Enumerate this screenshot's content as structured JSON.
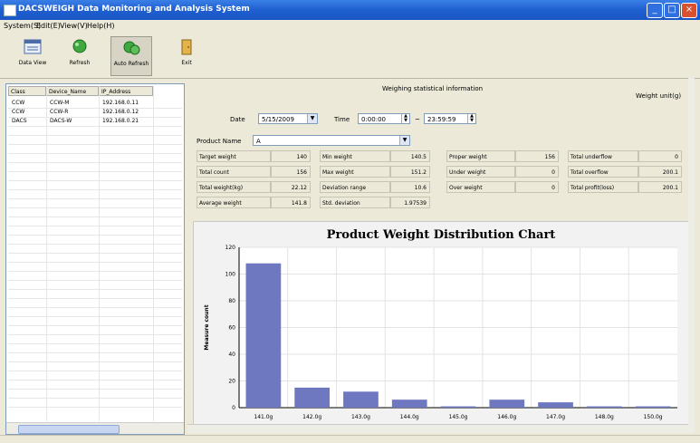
{
  "window": {
    "title": "DACSWEIGH Data Monitoring and Analysis System"
  },
  "menu": [
    "System(S)",
    "Edit(E)",
    "View(V)",
    "Help(H)"
  ],
  "toolbar": {
    "buttons": [
      {
        "label": "Data View",
        "icon": "data-view-icon"
      },
      {
        "label": "Refresh",
        "icon": "refresh-icon"
      },
      {
        "label": "Auto Refresh",
        "icon": "auto-refresh-icon"
      },
      {
        "label": "Exit",
        "icon": "exit-icon"
      }
    ]
  },
  "devices": {
    "headers": [
      "Class",
      "Device_Name",
      "IP_Address"
    ],
    "rows": [
      [
        "CCW",
        "CCW-M",
        "192.168.0.11"
      ],
      [
        "CCW",
        "CCW-R",
        "192.168.0.12"
      ],
      [
        "DACS",
        "DACS-W",
        "192.168.0.21"
      ]
    ]
  },
  "stats": {
    "title": "Weighing statistical information",
    "unit": "Weight unit(g)",
    "date_label": "Date",
    "date_value": "5/15/2009",
    "time_label": "Time",
    "time_from": "0:00:00",
    "time_sep": "~",
    "time_to": "23:59:59",
    "product_label": "Product Name",
    "product_value": "A",
    "col1": [
      {
        "name": "Target weight",
        "value": "140"
      },
      {
        "name": "Total count",
        "value": "156"
      },
      {
        "name": "Total weight(kg)",
        "value": "22.12"
      },
      {
        "name": "Average weight",
        "value": "141.8"
      }
    ],
    "col2": [
      {
        "name": "Min weight",
        "value": "140.5"
      },
      {
        "name": "Max weight",
        "value": "151.2"
      },
      {
        "name": "Deviation range",
        "value": "10.6"
      },
      {
        "name": "Std. deviation",
        "value": "1.97539"
      }
    ],
    "col3": [
      {
        "name": "Proper weight",
        "value": "156"
      },
      {
        "name": "Under weight",
        "value": "0"
      },
      {
        "name": "Over weight",
        "value": "0"
      }
    ],
    "col4": [
      {
        "name": "Total underflow",
        "value": "0"
      },
      {
        "name": "Total overflow",
        "value": "200.1"
      },
      {
        "name": "Total profit(loss)",
        "value": "200.1"
      }
    ]
  },
  "chart_data": {
    "type": "bar",
    "title": "Product Weight Distribution Chart",
    "ylabel": "Measure count",
    "xlabel": "",
    "ylim": [
      0,
      120
    ],
    "yticks": [
      0,
      20,
      40,
      60,
      80,
      100,
      120
    ],
    "categories": [
      "141.0g",
      "142.0g",
      "143.0g",
      "144.0g",
      "145.0g",
      "146.0g",
      "147.0g",
      "148.0g",
      "150.0g"
    ],
    "values": [
      108,
      15,
      12,
      6,
      1,
      6,
      4,
      1,
      1
    ],
    "colors": {
      "bar": "#6e78c0",
      "plot_bg": "#ffffff",
      "grid": "#e3e3e3"
    }
  }
}
